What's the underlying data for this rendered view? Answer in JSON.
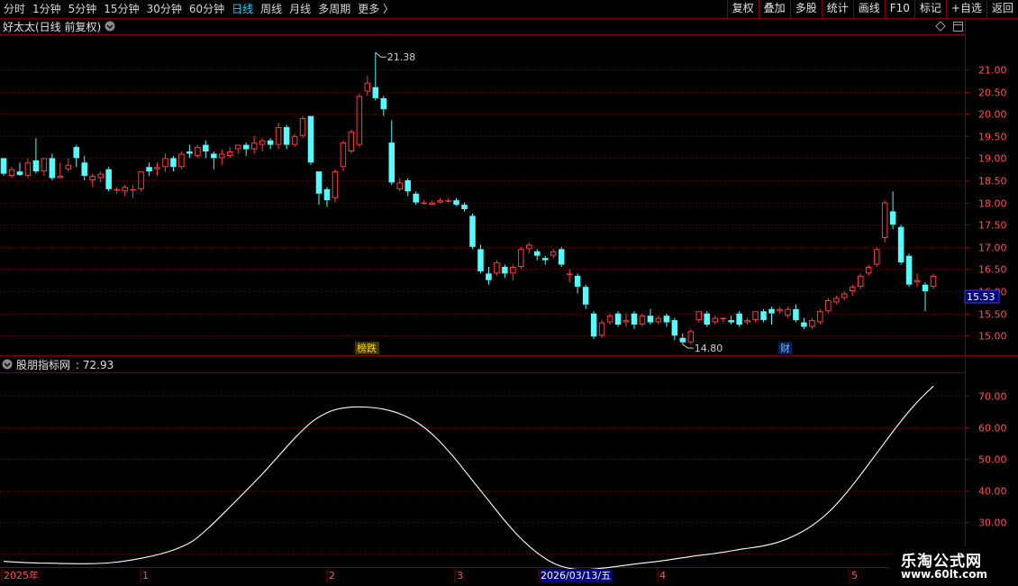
{
  "toolbar": {
    "left_items": [
      {
        "label": "分时",
        "active": false
      },
      {
        "label": "1分钟",
        "active": false
      },
      {
        "label": "5分钟",
        "active": false
      },
      {
        "label": "15分钟",
        "active": false
      },
      {
        "label": "30分钟",
        "active": false
      },
      {
        "label": "60分钟",
        "active": false
      },
      {
        "label": "日线",
        "active": true
      },
      {
        "label": "周线",
        "active": false
      },
      {
        "label": "月线",
        "active": false
      },
      {
        "label": "多周期",
        "active": false
      },
      {
        "label": "更多 〉",
        "active": false
      }
    ],
    "right_buttons": [
      "复权",
      "叠加",
      "多股",
      "统计",
      "画线",
      "F10",
      "标记",
      "+自选",
      "返回"
    ]
  },
  "main_panel": {
    "title": "好太太(日线 前复权)",
    "current_price": "15.53",
    "badges": [
      "榜跌",
      "财"
    ]
  },
  "indicator_panel": {
    "title": "股朋指标网",
    "value": ": 72.93"
  },
  "colors": {
    "up": "#ff3c3c",
    "down": "#54fcfc",
    "grid": "#800000",
    "axis_text": "#ff5050",
    "line": "#ffffff",
    "price_box": "#000080"
  },
  "chart_data": [
    {
      "type": "candlestick",
      "title": "好太太(日线 前复权)",
      "ylim": [
        14.6,
        21.75
      ],
      "y_ticks": [
        "15.00",
        "15.50",
        "16.00",
        "16.50",
        "17.00",
        "17.50",
        "18.00",
        "18.50",
        "19.00",
        "19.50",
        "20.00",
        "20.50",
        "21.00"
      ],
      "annotations": [
        {
          "label": "21.38",
          "at": "high"
        },
        {
          "label": "14.80",
          "at": "low"
        }
      ],
      "candles": [
        [
          19.0,
          18.65,
          19.0,
          18.6
        ],
        [
          18.6,
          18.75,
          18.8,
          18.55
        ],
        [
          18.7,
          18.62,
          18.9,
          18.6
        ],
        [
          18.6,
          18.9,
          19.0,
          18.55
        ],
        [
          18.95,
          18.7,
          19.45,
          18.65
        ],
        [
          18.7,
          19.0,
          19.0,
          18.6
        ],
        [
          19.0,
          18.55,
          19.1,
          18.5
        ],
        [
          18.55,
          18.6,
          18.9,
          18.55
        ],
        [
          18.75,
          18.85,
          19.0,
          18.7
        ],
        [
          19.25,
          19.0,
          19.3,
          18.8
        ],
        [
          18.9,
          18.6,
          19.05,
          18.5
        ],
        [
          18.5,
          18.6,
          18.65,
          18.35
        ],
        [
          18.55,
          18.65,
          18.7,
          18.45
        ],
        [
          18.75,
          18.3,
          18.8,
          18.25
        ],
        [
          18.3,
          18.3,
          18.35,
          18.2
        ],
        [
          18.25,
          18.35,
          18.4,
          18.15
        ],
        [
          18.3,
          18.3,
          18.4,
          18.1
        ],
        [
          18.3,
          18.7,
          18.7,
          18.25
        ],
        [
          18.8,
          18.7,
          18.9,
          18.6
        ],
        [
          18.75,
          18.8,
          18.9,
          18.6
        ],
        [
          18.8,
          19.0,
          19.1,
          18.7
        ],
        [
          19.0,
          18.8,
          19.05,
          18.7
        ],
        [
          18.8,
          19.1,
          19.15,
          18.75
        ],
        [
          19.15,
          19.1,
          19.3,
          19.0
        ],
        [
          19.05,
          19.25,
          19.3,
          19.0
        ],
        [
          19.3,
          19.15,
          19.4,
          19.0
        ],
        [
          19.1,
          19.0,
          19.15,
          18.75
        ],
        [
          19.0,
          19.1,
          19.2,
          18.85
        ],
        [
          19.05,
          19.15,
          19.25,
          19.0
        ],
        [
          19.2,
          19.3,
          19.3,
          19.1
        ],
        [
          19.3,
          19.2,
          19.35,
          19.05
        ],
        [
          19.2,
          19.35,
          19.5,
          19.1
        ],
        [
          19.3,
          19.4,
          19.45,
          19.15
        ],
        [
          19.4,
          19.3,
          19.45,
          19.2
        ],
        [
          19.3,
          19.7,
          19.8,
          19.2
        ],
        [
          19.7,
          19.3,
          19.75,
          19.2
        ],
        [
          19.3,
          19.5,
          19.55,
          19.25
        ],
        [
          19.5,
          19.9,
          19.95,
          19.45
        ],
        [
          19.95,
          18.9,
          19.95,
          18.85
        ],
        [
          18.7,
          18.2,
          18.7,
          17.95
        ],
        [
          18.3,
          18.05,
          18.35,
          17.9
        ],
        [
          18.1,
          18.7,
          18.75,
          18.0
        ],
        [
          18.8,
          19.35,
          19.4,
          18.7
        ],
        [
          19.15,
          19.6,
          19.65,
          19.1
        ],
        [
          19.3,
          20.4,
          20.45,
          19.25
        ],
        [
          20.5,
          20.7,
          20.85,
          20.4
        ],
        [
          20.6,
          20.35,
          21.38,
          20.3
        ],
        [
          20.35,
          20.1,
          20.4,
          19.95
        ],
        [
          19.35,
          18.45,
          19.85,
          18.4
        ],
        [
          18.3,
          18.45,
          18.55,
          18.25
        ],
        [
          18.5,
          18.25,
          18.55,
          18.15
        ],
        [
          18.2,
          18.0,
          18.25,
          17.95
        ],
        [
          18.0,
          18.0,
          18.05,
          17.95
        ],
        [
          17.95,
          18.0,
          18.05,
          17.95
        ],
        [
          18.0,
          18.05,
          18.1,
          17.98
        ],
        [
          18.05,
          18.05,
          18.1,
          18.0
        ],
        [
          18.05,
          17.95,
          18.1,
          17.92
        ],
        [
          17.95,
          17.85,
          18.0,
          17.8
        ],
        [
          17.7,
          17.0,
          17.75,
          16.95
        ],
        [
          16.95,
          16.45,
          17.05,
          16.4
        ],
        [
          16.4,
          16.25,
          16.55,
          16.15
        ],
        [
          16.4,
          16.65,
          16.7,
          16.35
        ],
        [
          16.55,
          16.4,
          16.6,
          16.3
        ],
        [
          16.4,
          16.55,
          16.6,
          16.25
        ],
        [
          16.55,
          16.95,
          17.0,
          16.5
        ],
        [
          16.95,
          17.05,
          17.1,
          16.85
        ],
        [
          16.9,
          16.8,
          16.95,
          16.7
        ],
        [
          16.75,
          16.7,
          16.8,
          16.6
        ],
        [
          16.8,
          16.9,
          16.95,
          16.75
        ],
        [
          16.95,
          16.6,
          17.0,
          16.55
        ],
        [
          16.4,
          16.4,
          16.5,
          16.2
        ],
        [
          16.35,
          16.1,
          16.4,
          15.95
        ],
        [
          16.1,
          15.7,
          16.15,
          15.6
        ],
        [
          15.5,
          14.98,
          15.55,
          14.92
        ],
        [
          15.0,
          15.3,
          15.35,
          14.95
        ],
        [
          15.3,
          15.45,
          15.5,
          15.25
        ],
        [
          15.5,
          15.25,
          15.55,
          15.2
        ],
        [
          15.3,
          15.35,
          15.5,
          15.2
        ],
        [
          15.5,
          15.25,
          15.55,
          15.15
        ],
        [
          15.25,
          15.45,
          15.5,
          15.2
        ],
        [
          15.45,
          15.3,
          15.6,
          15.25
        ],
        [
          15.3,
          15.4,
          15.45,
          15.25
        ],
        [
          15.45,
          15.3,
          15.5,
          15.2
        ],
        [
          15.35,
          15.0,
          15.4,
          14.9
        ],
        [
          14.95,
          14.85,
          15.05,
          14.8
        ],
        [
          14.85,
          15.1,
          15.15,
          14.8
        ],
        [
          15.35,
          15.55,
          15.55,
          15.3
        ],
        [
          15.5,
          15.25,
          15.55,
          15.2
        ],
        [
          15.3,
          15.4,
          15.45,
          15.25
        ],
        [
          15.4,
          15.4,
          15.42,
          15.3
        ],
        [
          15.35,
          15.3,
          15.45,
          15.25
        ],
        [
          15.5,
          15.25,
          15.55,
          15.2
        ],
        [
          15.3,
          15.35,
          15.4,
          15.25
        ],
        [
          15.35,
          15.55,
          15.55,
          15.3
        ],
        [
          15.55,
          15.35,
          15.6,
          15.3
        ],
        [
          15.6,
          15.5,
          15.65,
          15.25
        ],
        [
          15.55,
          15.6,
          15.65,
          15.5
        ],
        [
          15.45,
          15.6,
          15.65,
          15.4
        ],
        [
          15.6,
          15.35,
          15.7,
          15.3
        ],
        [
          15.3,
          15.2,
          15.4,
          15.15
        ],
        [
          15.2,
          15.35,
          15.4,
          15.15
        ],
        [
          15.3,
          15.55,
          15.6,
          15.25
        ],
        [
          15.55,
          15.8,
          15.85,
          15.5
        ],
        [
          15.75,
          15.85,
          15.9,
          15.7
        ],
        [
          15.85,
          15.95,
          16.0,
          15.8
        ],
        [
          16.0,
          16.1,
          16.15,
          15.9
        ],
        [
          16.1,
          16.35,
          16.4,
          16.05
        ],
        [
          16.4,
          16.55,
          16.6,
          16.35
        ],
        [
          16.6,
          16.95,
          17.0,
          16.55
        ],
        [
          17.2,
          18.0,
          18.05,
          17.1
        ],
        [
          17.8,
          17.5,
          18.25,
          17.4
        ],
        [
          17.45,
          16.65,
          17.5,
          16.6
        ],
        [
          16.8,
          16.15,
          16.85,
          16.1
        ],
        [
          16.2,
          16.25,
          16.4,
          16.1
        ],
        [
          16.15,
          16.0,
          16.2,
          15.55
        ],
        [
          16.1,
          16.35,
          16.4,
          16.05
        ]
      ]
    },
    {
      "type": "line",
      "title": "股朋指标网",
      "ylim": [
        16,
        77
      ],
      "y_ticks": [
        "20.00",
        "30.00",
        "40.00",
        "50.00",
        "60.00",
        "70.00"
      ],
      "x_labels": [
        "2025年",
        "1",
        "2",
        "3",
        "2026/03/13/五",
        "4",
        "5"
      ],
      "series": [
        {
          "name": "股朋指标网",
          "values": [
            17.5,
            17.2,
            17.0,
            16.9,
            16.8,
            16.8,
            17.0,
            17.6,
            18.5,
            19.7,
            21.4,
            24.0,
            28.6,
            33.9,
            39.4,
            45.0,
            51.0,
            57.0,
            62.0,
            65.0,
            66.2,
            66.3,
            65.7,
            64.2,
            61.5,
            57.2,
            51.4,
            44.7,
            37.9,
            31.1,
            25.0,
            20.2,
            16.8,
            15.2,
            15.0,
            15.5,
            16.2,
            16.9,
            17.5,
            18.3,
            19.1,
            19.8,
            20.6,
            21.5,
            22.3,
            23.6,
            25.8,
            29.0,
            33.5,
            39.5,
            46.5,
            53.8,
            61.0,
            67.5,
            72.93
          ]
        }
      ]
    }
  ]
}
